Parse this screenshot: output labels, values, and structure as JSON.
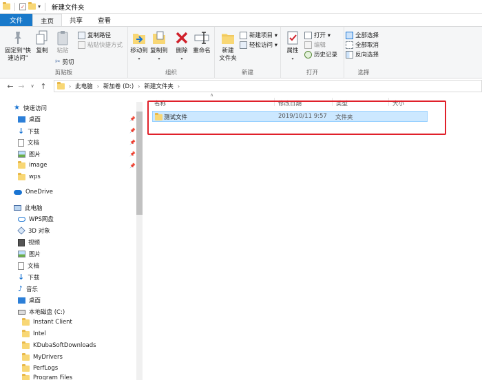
{
  "window": {
    "title": "新建文件夹"
  },
  "tabs": [
    {
      "label": "文件"
    },
    {
      "label": "主页"
    },
    {
      "label": "共享"
    },
    {
      "label": "查看"
    }
  ],
  "ribbon": {
    "clipboard": {
      "pin_label": "固定到\"快速访问\"",
      "copy_label": "复制",
      "paste_label": "粘贴",
      "copy_path_label": "复制路径",
      "paste_shortcut_label": "粘贴快捷方式",
      "cut_label": "剪切",
      "group_label": "剪贴板"
    },
    "organize": {
      "move_to_label": "移动到",
      "copy_to_label": "复制到",
      "delete_label": "删除",
      "rename_label": "重命名",
      "group_label": "组织"
    },
    "new": {
      "new_folder_label": "新建\n文件夹",
      "new_item_label": "新建项目 ▾",
      "easy_access_label": "轻松访问 ▾",
      "group_label": "新建"
    },
    "open": {
      "properties_label": "属性",
      "open_label": "打开 ▾",
      "edit_label": "编辑",
      "history_label": "历史记录",
      "group_label": "打开"
    },
    "select": {
      "select_all_label": "全部选择",
      "select_none_label": "全部取消",
      "invert_label": "反向选择",
      "group_label": "选择"
    }
  },
  "address": {
    "crumbs": [
      "此电脑",
      "新加卷 (D:)",
      "新建文件夹"
    ]
  },
  "nav": {
    "quick_access": "快速访问",
    "quick_items": [
      "桌面",
      "下载",
      "文档",
      "图片",
      "image",
      "wps"
    ],
    "onedrive": "OneDrive",
    "this_pc": "此电脑",
    "pc_items": [
      "WPS网盘",
      "3D 对象",
      "视频",
      "图片",
      "文档",
      "下载",
      "音乐",
      "桌面"
    ],
    "local_disk": "本地磁盘 (C:)",
    "disk_items": [
      "Instant Client",
      "Intel",
      "KDubaSoftDownloads",
      "MyDrivers",
      "PerfLogs",
      "Program Files"
    ]
  },
  "columns": {
    "name": "名称",
    "date": "修改日期",
    "type": "类型",
    "size": "大小"
  },
  "files": [
    {
      "name": "测试文件",
      "date": "2019/10/11 9:57",
      "type": "文件夹"
    }
  ],
  "colors": {
    "accent": "#1979ca",
    "selection": "#cce8ff",
    "highlight_box": "#e0202a",
    "folder": "#f8d775"
  }
}
